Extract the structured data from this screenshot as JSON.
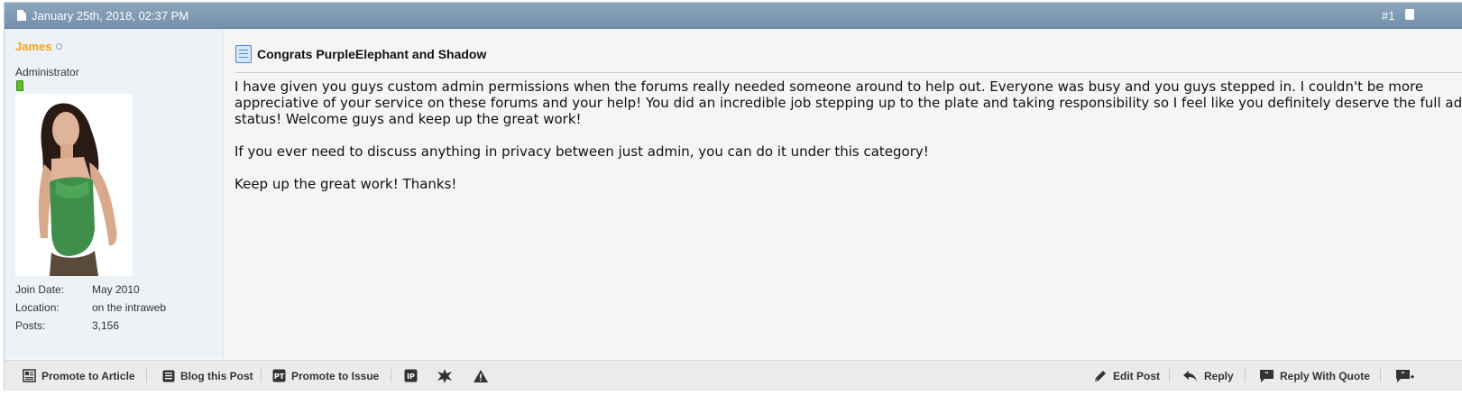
{
  "post": {
    "date": "January 25th, 2018, 02:37 PM",
    "number": "#1",
    "user": {
      "name": "James",
      "title": "Administrator",
      "stats": [
        {
          "label": "Join Date:",
          "value": "May 2010"
        },
        {
          "label": "Location:",
          "value": "on the intraweb"
        },
        {
          "label": "Posts:",
          "value": "3,156"
        }
      ]
    },
    "title": "Congrats PurpleElephant and Shadow",
    "paragraphs": [
      "I have given you guys custom admin permissions when the forums really needed someone around to help out. Everyone was busy and you guys stepped in. I couldn't be more appreciative of your service on these forums and your help! You did an incredible job stepping up to the plate and taking responsibility so I feel like you definitely deserve the full admin status! Welcome guys and keep up the great work!",
      "If you ever need to discuss anything in privacy between just admin, you can do it under this category!",
      "Keep up the great work! Thanks!"
    ]
  },
  "footer": {
    "promote_article": "Promote to Article",
    "blog_post": "Blog this Post",
    "promote_issue": "Promote to Issue",
    "edit_post": "Edit Post",
    "reply": "Reply",
    "reply_quote": "Reply With Quote"
  },
  "colors": {
    "header": "#7390ad",
    "username": "#f2a21a",
    "userinfo_bg": "#edf2f7"
  }
}
